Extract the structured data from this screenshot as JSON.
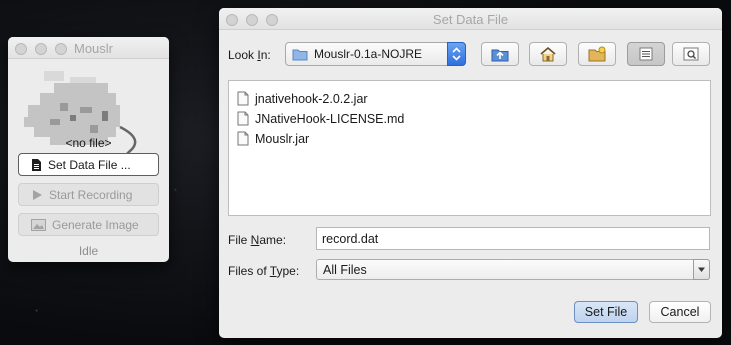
{
  "app_window": {
    "title": "Mouslr",
    "file_status": "<no file>",
    "buttons": {
      "set_data_file": "Set Data File ...",
      "start_recording": "Start Recording",
      "generate_image": "Generate Image"
    },
    "status": "Idle"
  },
  "dialog": {
    "title": "Set Data File",
    "look_in": {
      "label_prefix": "Look ",
      "label_mnemonic": "I",
      "label_suffix": "n:",
      "value": "Mouslr-0.1a-NOJRE"
    },
    "toolbar_icons": [
      "up-folder-icon",
      "home-icon",
      "new-folder-icon",
      "list-view-icon",
      "details-view-icon"
    ],
    "files": [
      {
        "name": "jnativehook-2.0.2.jar",
        "icon": "file-icon"
      },
      {
        "name": "JNativeHook-LICENSE.md",
        "icon": "file-icon"
      },
      {
        "name": "Mouslr.jar",
        "icon": "file-icon"
      }
    ],
    "file_name": {
      "label_prefix": "File ",
      "label_mnemonic": "N",
      "label_suffix": "ame:",
      "value": "record.dat"
    },
    "files_of_type": {
      "label_prefix": "Files of ",
      "label_mnemonic": "T",
      "label_suffix": "ype:",
      "value": "All Files"
    },
    "buttons": {
      "set_file": "Set File",
      "cancel": "Cancel"
    }
  },
  "colors": {
    "accent_blue": "#2f6fe0",
    "window_bg": "#ececec",
    "default_button": "#bfd3ef"
  }
}
